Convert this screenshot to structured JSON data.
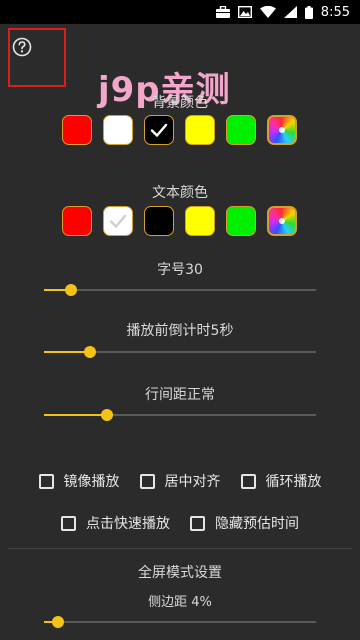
{
  "status_bar": {
    "time": "8:55"
  },
  "watermark": "j9p亲测",
  "background_color": {
    "title": "背景颜色",
    "swatches": [
      "#ff0000",
      "#ffffff",
      "#000000",
      "#ffff00",
      "#00ee00",
      "color-wheel"
    ],
    "selected_index": 2
  },
  "text_color": {
    "title": "文本颜色",
    "swatches": [
      "#ff0000",
      "#ffffff",
      "#000000",
      "#ffff00",
      "#00ee00",
      "color-wheel"
    ],
    "selected_index": 1
  },
  "font_size": {
    "label": "字号30",
    "value_fraction": 0.1
  },
  "countdown": {
    "label": "播放前倒计时5秒",
    "value_fraction": 0.17
  },
  "line_spacing": {
    "label": "行间距正常",
    "value_fraction": 0.23
  },
  "options": {
    "mirror": "镜像播放",
    "center": "居中对齐",
    "loop": "循环播放",
    "tap_fast": "点击快速播放",
    "hide_estimate": "隐藏预估时间"
  },
  "fullscreen": {
    "title": "全屏模式设置",
    "margin_label": "侧边距 4%",
    "margin_fraction": 0.05
  },
  "colors": {
    "accent": "#f4c31a",
    "swatch_border": "#d3a02a",
    "help_highlight": "#d81e1e"
  }
}
